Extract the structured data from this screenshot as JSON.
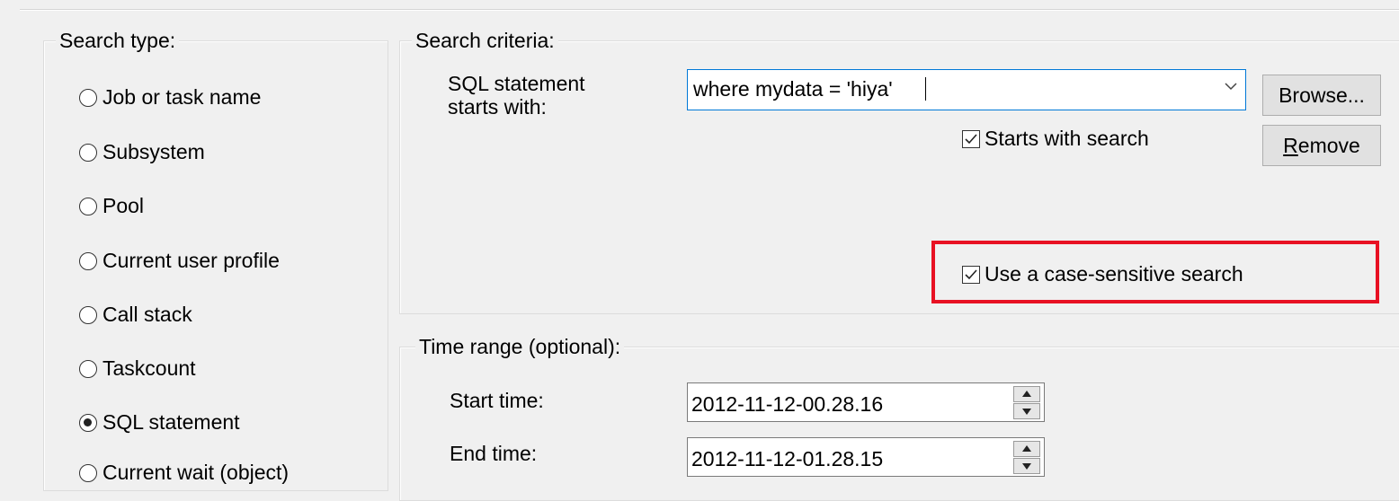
{
  "search_type": {
    "legend": "Search type:",
    "options": [
      {
        "label": "Job or task name",
        "checked": false
      },
      {
        "label": "Subsystem",
        "checked": false
      },
      {
        "label": "Pool",
        "checked": false
      },
      {
        "label": "Current user profile",
        "checked": false
      },
      {
        "label": "Call stack",
        "checked": false
      },
      {
        "label": "Taskcount",
        "checked": false
      },
      {
        "label": "SQL statement",
        "checked": true
      },
      {
        "label": "Current wait (object)",
        "checked": false
      }
    ]
  },
  "search_criteria": {
    "legend": "Search criteria:",
    "field_label_line1": "SQL statement",
    "field_label_line2": "starts with:",
    "field_value": "where mydata = 'hiya'",
    "browse_label": "Browse...",
    "remove_label_mnemonic": "R",
    "remove_label_rest": "emove",
    "starts_with_search": {
      "label": "Starts with search",
      "checked": true
    },
    "case_sensitive": {
      "label": "Use a case-sensitive search",
      "checked": true
    }
  },
  "time_range": {
    "legend": "Time range (optional):",
    "start_label": "Start time:",
    "start_value": "2012-11-12-00.28.16",
    "end_label": "End time:",
    "end_value": "2012-11-12-01.28.15"
  },
  "colors": {
    "highlight": "#e81123",
    "focus_border": "#0078d7"
  }
}
